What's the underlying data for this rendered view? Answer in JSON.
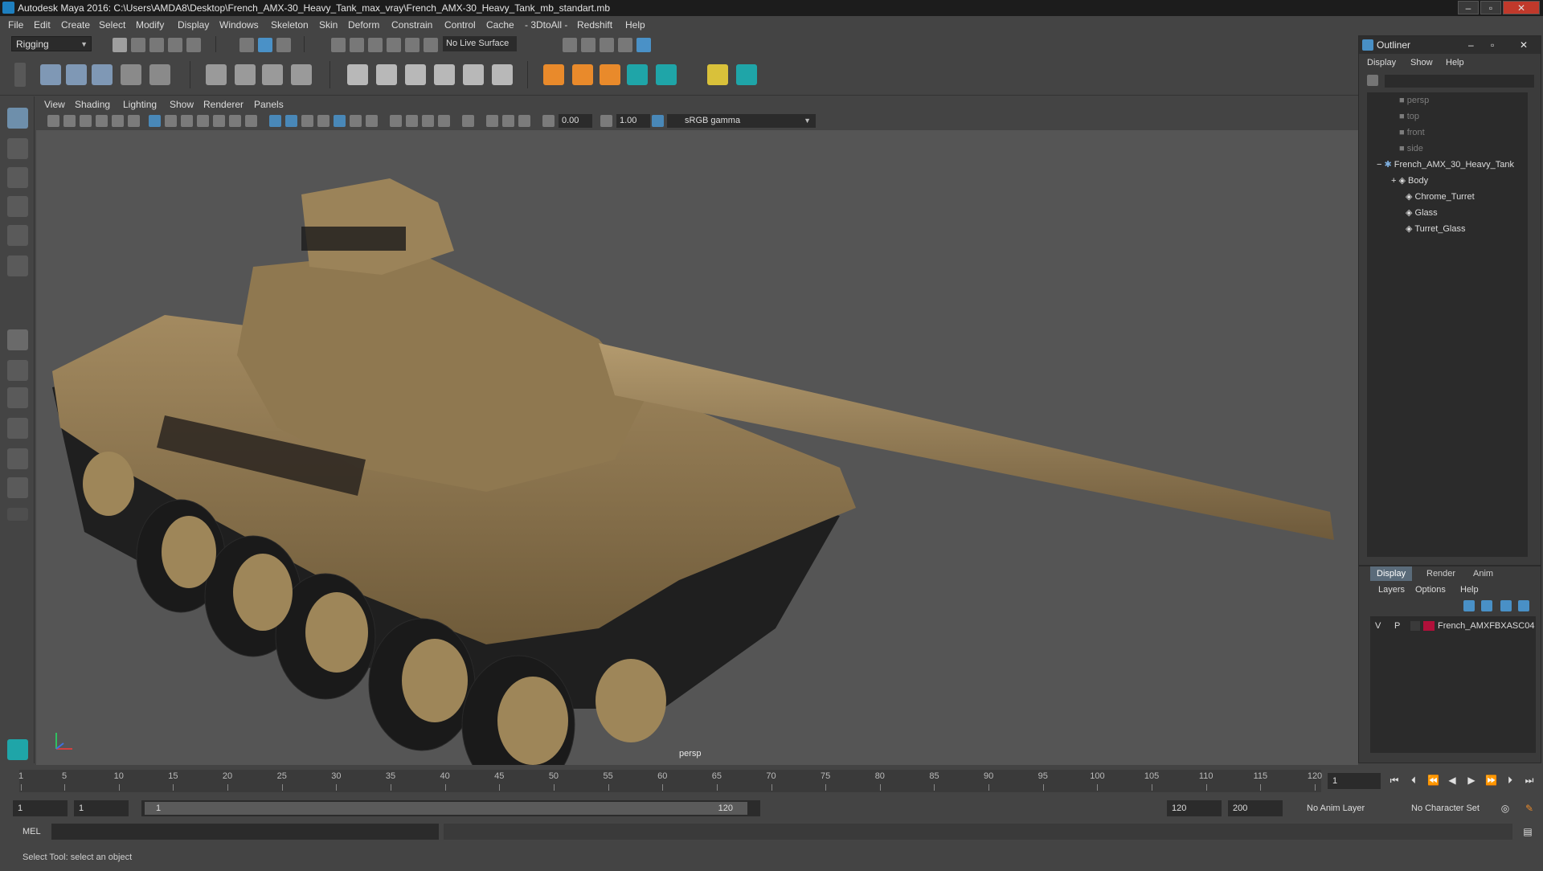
{
  "titlebar": {
    "title": "Autodesk Maya 2016: C:\\Users\\AMDA8\\Desktop\\French_AMX-30_Heavy_Tank_max_vray\\French_AMX-30_Heavy_Tank_mb_standart.mb",
    "minimize": "–",
    "maximize": "▫",
    "close": "✕"
  },
  "menubar": {
    "items": [
      "File",
      "Edit",
      "Create",
      "Select",
      "Modify",
      "Display",
      "Windows",
      "Skeleton",
      "Skin",
      "Deform",
      "Constrain",
      "Control",
      "Cache",
      "- 3DtoAll -",
      "Redshift",
      "Help"
    ]
  },
  "shelf": {
    "mode": "Rigging",
    "live_surface": "No Live Surface"
  },
  "viewport": {
    "menu": [
      "View",
      "Shading",
      "Lighting",
      "Show",
      "Renderer",
      "Panels"
    ],
    "exposure": "0.00",
    "gamma_value": "1.00",
    "color_space": "sRGB gamma",
    "camera": "persp"
  },
  "outliner": {
    "title": "Outliner",
    "menu": [
      "Display",
      "Show",
      "Help"
    ],
    "items": [
      "persp",
      "top",
      "front",
      "side",
      "French_AMX_30_Heavy_Tank",
      "Body",
      "Chrome_Turret",
      "Glass",
      "Turret_Glass"
    ],
    "expand_glyph": "+",
    "collapse_glyph": "−"
  },
  "layers": {
    "tabs": [
      "Display",
      "Render",
      "Anim"
    ],
    "menu": [
      "Layers",
      "Options",
      "Help"
    ],
    "layer": {
      "v": "V",
      "p": "P",
      "name": "French_AMXFBXASC04",
      "color": "#b0103a"
    }
  },
  "timeline": {
    "ticks": [
      "1",
      "5",
      "10",
      "15",
      "20",
      "25",
      "30",
      "35",
      "40",
      "45",
      "50",
      "55",
      "60",
      "65",
      "70",
      "75",
      "80",
      "85",
      "90",
      "95",
      "100",
      "105",
      "110",
      "115",
      "120"
    ],
    "current_frame": "1"
  },
  "range": {
    "start": "1",
    "playback_start": "1",
    "slider_start": "1",
    "slider_end": "120",
    "playback_end": "120",
    "end": "200",
    "anim_layer": "No Anim Layer",
    "character_set": "No Character Set"
  },
  "command": {
    "label": "MEL"
  },
  "help": {
    "text": "Select Tool: select an object"
  },
  "colors": {
    "accent": "#4b9ad6",
    "background": "#444444",
    "viewport": "#555555"
  }
}
